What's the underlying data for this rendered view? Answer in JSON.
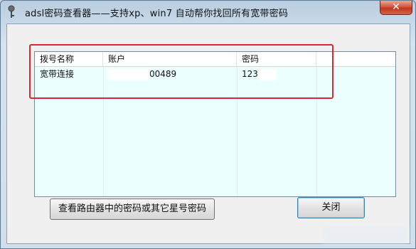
{
  "window": {
    "title": "adsl密码查看器——支持xp、win7 自动帮你找回所有宽带密码",
    "close_glyph": "✕"
  },
  "list": {
    "columns": [
      "拨号名称",
      "账户",
      "密码"
    ],
    "rows": [
      {
        "name": "宽带连接",
        "account": "00489",
        "password": "123"
      }
    ]
  },
  "buttons": {
    "router_label": "查看路由器中的密码或其它星号密码",
    "close_label": "关闭"
  },
  "colors": {
    "list_bg": "#ecffff",
    "highlight": "#e0252e"
  }
}
